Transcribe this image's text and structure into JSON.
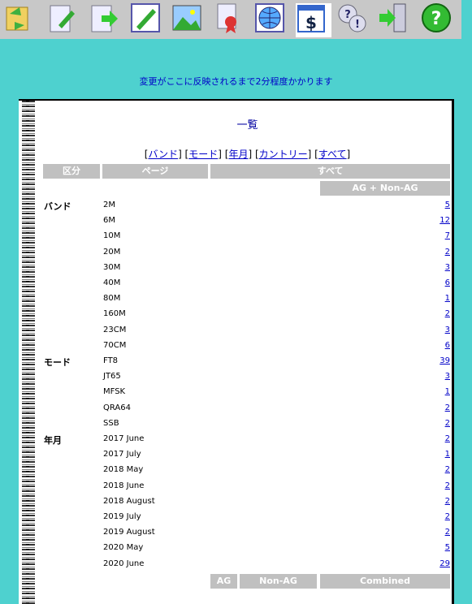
{
  "toolbar": {
    "icons": [
      "refresh-icon",
      "edit-document-icon",
      "export-document-icon",
      "pencil-icon",
      "landscape-image-icon",
      "certificate-icon",
      "globe-icon",
      "calendar-dollar-icon",
      "help-balloon-icon",
      "exit-door-icon",
      "help-circle-icon"
    ]
  },
  "notice": "変更がここに反映されるまで2分程度かかります",
  "page_title": "一覧",
  "nav_links": [
    "バンド",
    "モード",
    "年月",
    "カントリー",
    "すべて"
  ],
  "table": {
    "headers": [
      "区分",
      "ページ",
      "すべて"
    ],
    "subheader": "AG + Non-AG",
    "footer_headers": [
      "AG",
      "Non-AG",
      "Combined"
    ],
    "groups": [
      {
        "category": "バンド",
        "rows": [
          {
            "page": "2M",
            "count": "5"
          },
          {
            "page": "6M",
            "count": "12"
          },
          {
            "page": "10M",
            "count": "7"
          },
          {
            "page": "20M",
            "count": "2"
          },
          {
            "page": "30M",
            "count": "3"
          },
          {
            "page": "40M",
            "count": "6"
          },
          {
            "page": "80M",
            "count": "1"
          },
          {
            "page": "160M",
            "count": "2"
          },
          {
            "page": "23CM",
            "count": "3"
          },
          {
            "page": "70CM",
            "count": "6"
          }
        ]
      },
      {
        "category": "モード",
        "rows": [
          {
            "page": "FT8",
            "count": "39"
          },
          {
            "page": "JT65",
            "count": "3"
          },
          {
            "page": "MFSK",
            "count": "1"
          },
          {
            "page": "QRA64",
            "count": "2"
          },
          {
            "page": "SSB",
            "count": "2"
          }
        ]
      },
      {
        "category": "年月",
        "rows": [
          {
            "page": "2017 June",
            "count": "2"
          },
          {
            "page": "2017 July",
            "count": "1"
          },
          {
            "page": "2018 May",
            "count": "2"
          },
          {
            "page": "2018 June",
            "count": "2"
          },
          {
            "page": "2018 August",
            "count": "2"
          },
          {
            "page": "2019 July",
            "count": "2"
          },
          {
            "page": "2019 August",
            "count": "2"
          },
          {
            "page": "2020 May",
            "count": "5"
          },
          {
            "page": "2020 June",
            "count": "29"
          }
        ]
      }
    ]
  }
}
